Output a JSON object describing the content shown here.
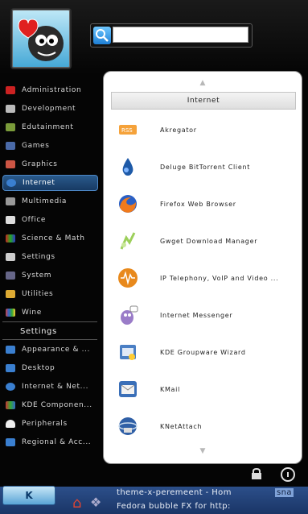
{
  "search": {
    "placeholder": "",
    "value": ""
  },
  "categories": [
    {
      "label": "Administration",
      "icon": "administration-icon",
      "color": "#c22"
    },
    {
      "label": "Development",
      "icon": "development-icon",
      "color": "#bbb"
    },
    {
      "label": "Edutainment",
      "icon": "edutainment-icon",
      "color": "#7a9b3a"
    },
    {
      "label": "Games",
      "icon": "games-icon",
      "color": "#4a6aa8"
    },
    {
      "label": "Graphics",
      "icon": "graphics-icon",
      "color": "#c54"
    },
    {
      "label": "Internet",
      "icon": "internet-icon",
      "color": "#3a7fd0",
      "active": true
    },
    {
      "label": "Multimedia",
      "icon": "multimedia-icon",
      "color": "#999"
    },
    {
      "label": "Office",
      "icon": "office-icon",
      "color": "#ddd"
    },
    {
      "label": "Science & Math",
      "icon": "science-icon",
      "color": "#2a2"
    },
    {
      "label": "Settings",
      "icon": "settings-icon",
      "color": "#ccc"
    },
    {
      "label": "System",
      "icon": "system-icon",
      "color": "#668"
    },
    {
      "label": "Utilities",
      "icon": "utilities-icon",
      "color": "#da3"
    },
    {
      "label": "Wine",
      "icon": "wine-icon",
      "color": "#c44"
    }
  ],
  "settings_header": "Settings",
  "settings_items": [
    {
      "label": "Appearance & ...",
      "icon": "appearance-icon",
      "color": "#3a7fd0"
    },
    {
      "label": "Desktop",
      "icon": "desktop-icon",
      "color": "#3a7fd0"
    },
    {
      "label": "Internet & Net...",
      "icon": "network-icon",
      "color": "#3a7fd0"
    },
    {
      "label": "KDE Componen...",
      "icon": "kde-components-icon",
      "color": "#c33"
    },
    {
      "label": "Peripherals",
      "icon": "peripherals-icon",
      "color": "#eee"
    },
    {
      "label": "Regional & Acc...",
      "icon": "regional-icon",
      "color": "#3a7fd0"
    }
  ],
  "panel": {
    "up_arrow": "▲",
    "down_arrow": "▼",
    "title": "Internet",
    "apps": [
      {
        "label": "Akregator",
        "icon": "akregator-icon"
      },
      {
        "label": "Deluge BitTorrent Client",
        "icon": "deluge-icon"
      },
      {
        "label": "Firefox Web Browser",
        "icon": "firefox-icon"
      },
      {
        "label": "Gwget Download Manager",
        "icon": "gwget-icon"
      },
      {
        "label": "IP Telephony, VoIP and Video ...",
        "icon": "telephony-icon"
      },
      {
        "label": "Internet Messenger",
        "icon": "messenger-icon"
      },
      {
        "label": "KDE Groupware Wizard",
        "icon": "groupware-icon"
      },
      {
        "label": "KMail",
        "icon": "kmail-icon"
      },
      {
        "label": "KNetAttach",
        "icon": "knetattach-icon"
      }
    ]
  },
  "taskbar": {
    "k_label": "K",
    "task1": "theme-x-peremeent - Hom",
    "task2": "Fedora bubble FX for http:",
    "task3": "sna"
  }
}
